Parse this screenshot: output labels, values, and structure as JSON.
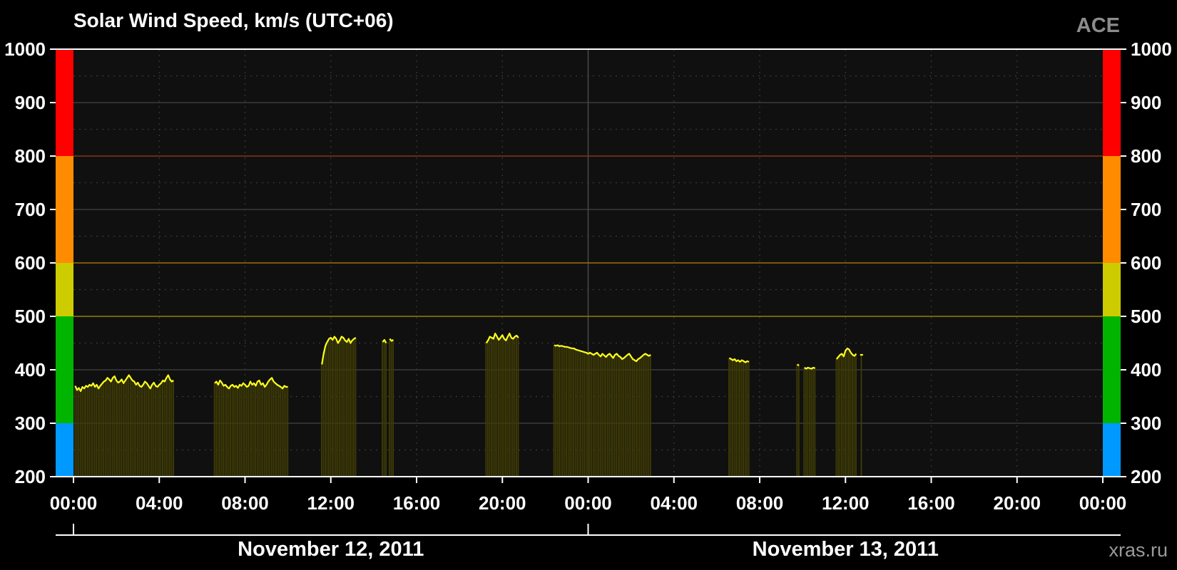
{
  "title": "Solar Wind Speed, km/s (UTC+06)",
  "source": "ACE",
  "credit": "xras.ru",
  "colors": {
    "background": "#000000",
    "plot_background": "#101010",
    "grid": "#3a3a3a",
    "bar_fill": "#3f3c05",
    "trace": "#ffff1e",
    "text": "#ffffff",
    "frame": "#ffffff"
  },
  "chart_data": {
    "type": "area",
    "ylim": [
      200,
      1000
    ],
    "xlim": [
      "2011-11-12 00:00",
      "2011-11-14 00:00"
    ],
    "y_ticks": [
      200,
      300,
      400,
      500,
      600,
      700,
      800,
      900,
      1000
    ],
    "x_tick_labels": [
      "00:00",
      "04:00",
      "08:00",
      "12:00",
      "16:00",
      "20:00",
      "00:00",
      "04:00",
      "08:00",
      "12:00",
      "16:00",
      "20:00",
      "00:00"
    ],
    "dates": [
      "November 12, 2011",
      "November 13, 2011"
    ],
    "grid": true,
    "threshold_lines": [
      {
        "value": 500,
        "color": "#8a7a00"
      },
      {
        "value": 600,
        "color": "#9a6a00"
      },
      {
        "value": 800,
        "color": "#8a2a12"
      }
    ],
    "scale_bands": [
      {
        "from": 200,
        "to": 300,
        "color": "#0099ff"
      },
      {
        "from": 300,
        "to": 500,
        "color": "#00b400"
      },
      {
        "from": 500,
        "to": 600,
        "color": "#cccc00"
      },
      {
        "from": 600,
        "to": 800,
        "color": "#ff8c00"
      },
      {
        "from": 800,
        "to": 1000,
        "color": "#ff0000"
      }
    ],
    "series": [
      {
        "segments": [
          {
            "start": "2011-11-12 00:05",
            "values": [
              370,
              362,
              366,
              360,
              368,
              365,
              370,
              368,
              372,
              370,
              375,
              368,
              372,
              365,
              370,
              374,
              378,
              380,
              385,
              382,
              378,
              385,
              388,
              380,
              376,
              378,
              382,
              375,
              380,
              385,
              390,
              385,
              380,
              378,
              372,
              376,
              370,
              368,
              372,
              378,
              375,
              370,
              365,
              372,
              376,
              370,
              368,
              372,
              375,
              380,
              378,
              385,
              390,
              382,
              378,
              380
            ]
          },
          {
            "start": "2011-11-12 06:35",
            "values": [
              375,
              378,
              372,
              380,
              376,
              370,
              372,
              368,
              365,
              370,
              372,
              368,
              370,
              366,
              372,
              370,
              375,
              372,
              368,
              370,
              378,
              372,
              375,
              370,
              378,
              380,
              372,
              375,
              368,
              372,
              378,
              382,
              385,
              378,
              375,
              372,
              370,
              368,
              365,
              370,
              368,
              368
            ]
          },
          {
            "start": "2011-11-12 11:35",
            "values": [
              410,
              430,
              445,
              452,
              458,
              460,
              456,
              462,
              458,
              450,
              455,
              462,
              460,
              455,
              452,
              458,
              450,
              455,
              458,
              460
            ]
          },
          {
            "start": "2011-11-12 14:25",
            "values": [
              452,
              456,
              450
            ]
          },
          {
            "start": "2011-11-12 14:45",
            "values": [
              458,
              454,
              456
            ]
          },
          {
            "start": "2011-11-12 19:15",
            "values": [
              450,
              455,
              462,
              460,
              458,
              468,
              462,
              456,
              460,
              465,
              458,
              455,
              462,
              468,
              460,
              458,
              462,
              464,
              460
            ]
          },
          {
            "start": "2011-11-12 22:25",
            "values": [
              446,
              445,
              446,
              444,
              445,
              444,
              443,
              443,
              442,
              441,
              440,
              440,
              438,
              437,
              436,
              435,
              434,
              433,
              432,
              430,
              432,
              430,
              428,
              430,
              432,
              428,
              425,
              430,
              427,
              424,
              428,
              430,
              426,
              422,
              428,
              430,
              426,
              424,
              420,
              422,
              425,
              428,
              430,
              425,
              420,
              418,
              416,
              420,
              422,
              425,
              428,
              430,
              428,
              426,
              428
            ]
          },
          {
            "start": "2011-11-13 06:35",
            "values": [
              422,
              420,
              418,
              420,
              416,
              418,
              415,
              418,
              416,
              414,
              416,
              415
            ]
          },
          {
            "start": "2011-11-13 09:45",
            "values": [
              410,
              408
            ]
          },
          {
            "start": "2011-11-13 10:05",
            "values": [
              404,
              402,
              404,
              403,
              402,
              404,
              403
            ]
          },
          {
            "start": "2011-11-13 11:35",
            "values": [
              420,
              424,
              428,
              430,
              425,
              436,
              440,
              438,
              432,
              428,
              426,
              430
            ]
          },
          {
            "start": "2011-11-13 12:45",
            "values": [
              428
            ]
          }
        ]
      }
    ]
  }
}
